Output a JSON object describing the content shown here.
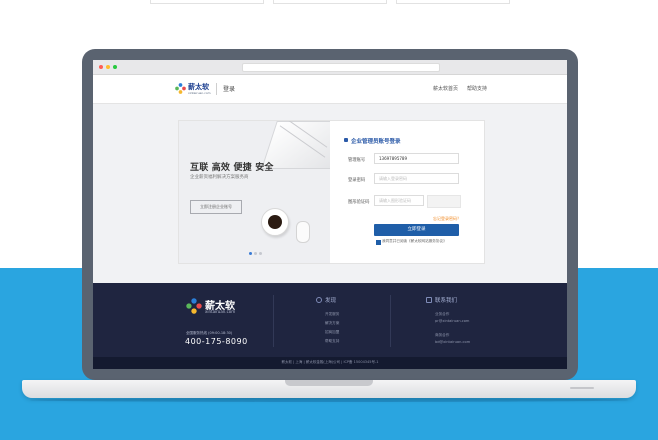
{
  "colors": {
    "brand_blue": "#1f5ea8",
    "footer_bg": "#1f2540",
    "background_blue": "#2aa5e0",
    "accent_orange": "#f08a24",
    "laptop_frame": "#5a6370"
  },
  "header": {
    "logo_text": "薪太软",
    "logo_sub": "xintairuan.com",
    "page_title": "登录",
    "nav": [
      "薪太软首页",
      "帮助支持"
    ]
  },
  "banner": {
    "slogan": "互联 高效 便捷 安全",
    "subtitle": "企业薪资福利解决方案服务商",
    "button": "立即注册企业账号",
    "slide_count": 3,
    "active_slide": 1
  },
  "login_form": {
    "title": "企业管理员账号登录",
    "fields": [
      {
        "label": "管理账号",
        "value": "13697895789",
        "placeholder": ""
      },
      {
        "label": "登录密码",
        "value": "",
        "placeholder": "请输入登录密码"
      },
      {
        "label": "图形验证码",
        "value": "",
        "placeholder": "请输入图形验证码"
      }
    ],
    "forgot": "忘记登录密码？",
    "submit": "立即登录",
    "agreement": "我同意并已阅读《薪太软网站服务协议》"
  },
  "footer": {
    "logo_text": "薪太软",
    "logo_sub": "xintairuan.com",
    "hotline_label": "全国服务热线 (09:00-18:30)",
    "phone": "400-175-8090",
    "discover": {
      "title": "发现",
      "items": [
        "开发服务",
        "解决方案",
        "招商加盟",
        "帮助支持"
      ]
    },
    "contact": {
      "title": "联系我们",
      "items": [
        {
          "label": "业务合作",
          "value": "pr@xintairuan.com"
        },
        {
          "label": "商务合作",
          "value": "bd@xintairuan.com"
        }
      ]
    },
    "copyright": "薪太软 | 上海 | 薪太软金融(上海)公司 | ICP备 15004345号-1"
  }
}
